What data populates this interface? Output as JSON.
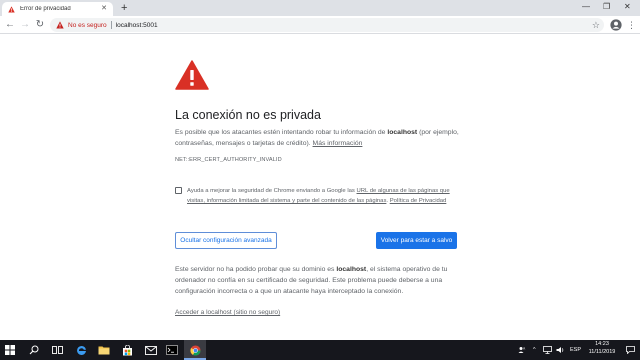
{
  "tab": {
    "title": "Error de privacidad"
  },
  "toolbar": {
    "not_secure_label": "No es seguro",
    "url": "localhost:5001"
  },
  "page": {
    "heading": "La conexión no es privada",
    "intro_before": "Es posible que los atacantes estén intentando robar tu información de ",
    "intro_host": "localhost",
    "intro_after": " (por ejemplo, contraseñas, mensajes o tarjetas de crédito). ",
    "more_info_link": "Más información",
    "error_code": "NET::ERR_CERT_AUTHORITY_INVALID",
    "checkbox_text_before": "Ayuda a mejorar la seguridad de Chrome enviando a Google las ",
    "checkbox_link_1": "URL de algunas de las páginas que visitas, información limitada del sistema y parte del contenido de las páginas",
    "checkbox_text_mid": ". ",
    "checkbox_link_2": "Política de Privacidad",
    "advanced_button": "Ocultar configuración avanzada",
    "back_button": "Volver para estar a salvo",
    "details_before": "Este servidor no ha podido probar que su dominio es ",
    "details_host": "localhost",
    "details_after": ", el sistema operativo de tu ordenador no confía en su certificado de seguridad. Este problema puede deberse a una configuración incorrecta o a que un atacante haya interceptado la conexión.",
    "proceed_link": "Acceder a localhost (sitio no seguro)"
  },
  "taskbar": {
    "tray_lang": "ESP",
    "time": "14:23",
    "date": "11/11/2019"
  },
  "colors": {
    "warning_red": "#d93025",
    "primary_blue": "#1a73e8",
    "taskbar_bg": "#16171d"
  }
}
